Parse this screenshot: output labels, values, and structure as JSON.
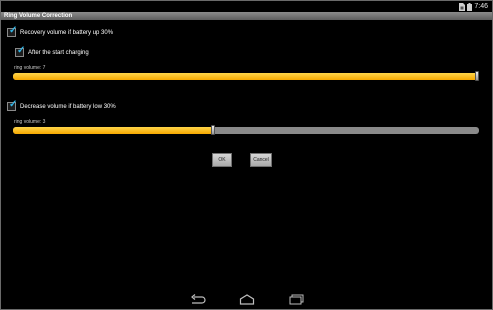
{
  "status": {
    "time": "7:46"
  },
  "title": "Ring Volume Correction",
  "settings": {
    "recovery": {
      "label": "Recovery volume if battery up 30%",
      "checked": true
    },
    "after_charging": {
      "label": "After the start charging",
      "checked": true
    },
    "recovery_ring_volume": {
      "label": "ring volume: 7",
      "value": 7,
      "max": 7
    },
    "decrease": {
      "label": "Decrease volume if battery low 30%",
      "checked": true
    },
    "decrease_ring_volume": {
      "label": "ring volume: 3",
      "value": 3,
      "max": 7
    }
  },
  "buttons": {
    "ok": "OK",
    "cancel": "Cancel"
  },
  "icons": {
    "check": "check-icon",
    "sim": "sim-icon",
    "battery": "battery-icon",
    "back": "back-icon",
    "home": "home-icon",
    "recents": "recents-icon"
  },
  "colors": {
    "accent": "#33b5e5",
    "slider_fill": "#f6a800",
    "slider_track": "#8a8a8a"
  }
}
